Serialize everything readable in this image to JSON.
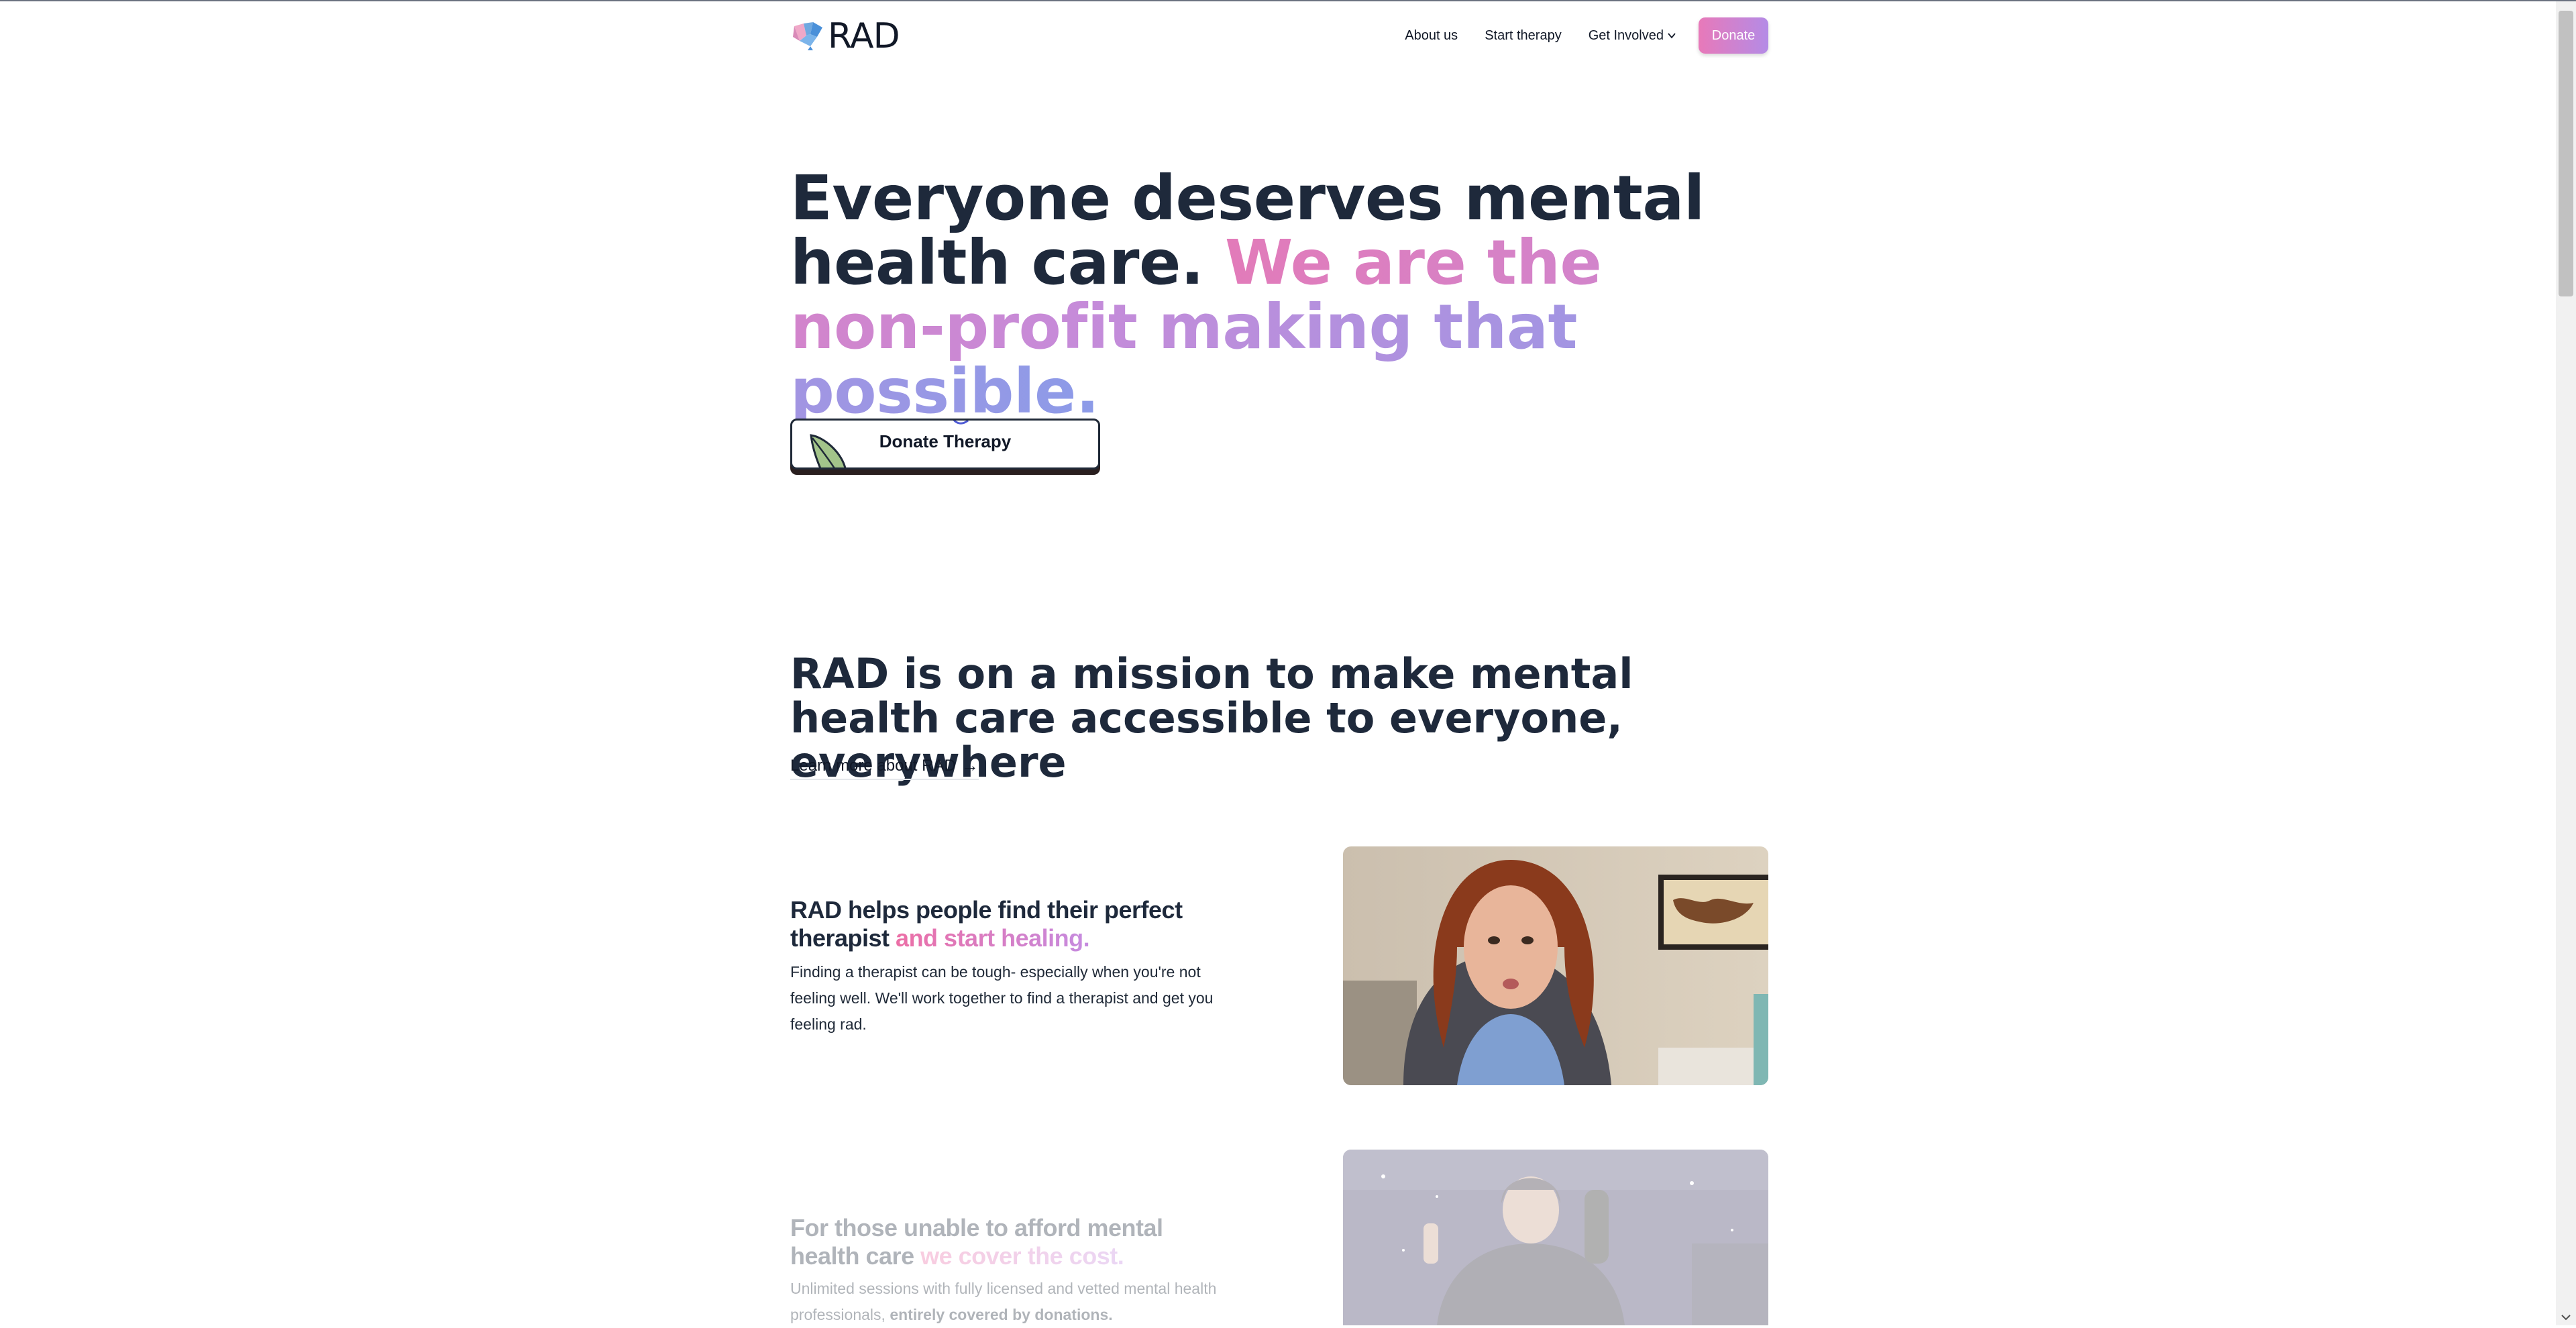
{
  "header": {
    "logo_text": "RAD",
    "nav": {
      "about": "About us",
      "start": "Start therapy",
      "involved": "Get Involved",
      "donate": "Donate"
    }
  },
  "hero": {
    "title_plain": "Everyone deserves mental health care. ",
    "title_gradient": "We are the non-profit making that possible.",
    "cta": "Donate Therapy"
  },
  "mission": {
    "title": "RAD is on a mission to make mental health care accessible to everyone, everywhere",
    "link": "Learn more about RAD",
    "link_arrow": "→"
  },
  "features": [
    {
      "title_plain": "RAD helps people find their perfect therapist ",
      "title_gradient": "and start healing.",
      "text": "Finding a therapist can be tough- especially when you're not feeling well. We'll work together to find a therapist and get you feeling rad."
    },
    {
      "title_plain": "For those unable to afford mental health care ",
      "title_gradient": "we cover the cost.",
      "text_plain": "Unlimited sessions with fully licensed and vetted mental health professionals, ",
      "text_bold": "entirely covered by donations."
    }
  ],
  "colors": {
    "brand_pink": "#e879b9",
    "brand_purple": "#b48be6",
    "brand_blue": "#8c9be8",
    "heading": "#1e293b"
  },
  "icons": [
    "brain-logo-icon",
    "chevron-down-icon",
    "leaf-icon",
    "arrow-right-icon"
  ]
}
